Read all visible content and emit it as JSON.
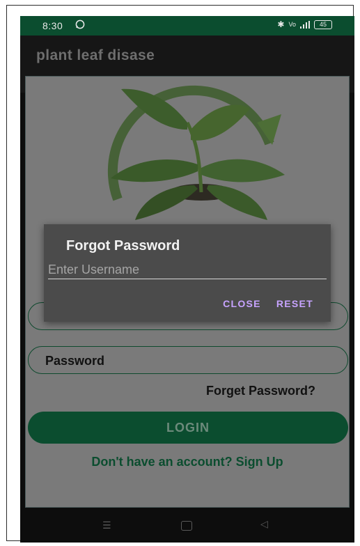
{
  "status_bar": {
    "time": "8:30",
    "right_icons": "✱ ⓨ ⁴ᴳ",
    "battery": "45"
  },
  "app_bar": {
    "title": "plant leaf disase"
  },
  "form": {
    "username_label": "",
    "password_label": "Password",
    "forget_password": "Forget Password?",
    "login_label": "LOGIN",
    "signup_text": "Don't have an account? Sign Up"
  },
  "dialog": {
    "title": "Forgot Password",
    "input_placeholder": "Enter Username",
    "input_value": "",
    "close_label": "CLOSE",
    "reset_label": "RESET"
  },
  "nav": {
    "menu_icon": "☰",
    "back_icon": "◁"
  },
  "colors": {
    "accent": "#0b4d2f",
    "dialog_button": "#c7a3ff",
    "scrim": "#7a7a7a"
  },
  "icons": [
    "whatsapp-icon",
    "bluetooth-icon",
    "volte-icon",
    "signal-icon",
    "battery-icon",
    "plant-logo-icon",
    "menu-icon",
    "home-icon",
    "back-icon"
  ]
}
